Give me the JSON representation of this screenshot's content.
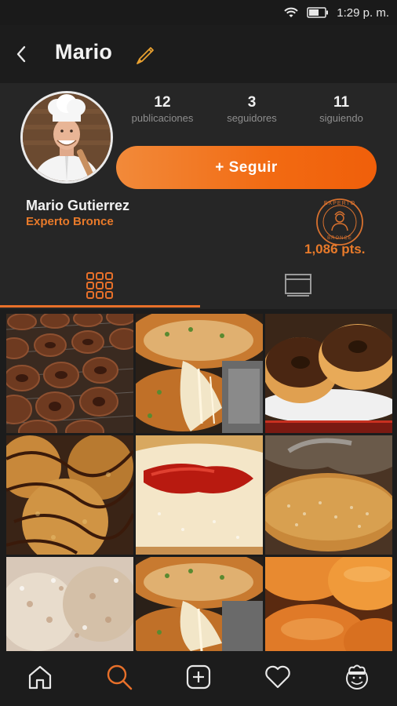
{
  "status_bar": {
    "time": "1:29 p. m.",
    "wifi_icon": "wifi-icon",
    "battery_icon": "battery-icon"
  },
  "header": {
    "back_icon": "back-arrow-icon",
    "title": "Mario",
    "edit_icon": "pencil-icon"
  },
  "profile": {
    "stats": [
      {
        "value": "12",
        "label": "publicaciones"
      },
      {
        "value": "3",
        "label": "seguidores"
      },
      {
        "value": "11",
        "label": "siguiendo"
      }
    ],
    "follow_button": "+ Seguir",
    "full_name": "Mario Gutierrez",
    "rank": "Experto Bronce",
    "badge": {
      "top_text": "EXPERTO",
      "bottom_text": "BRONCE"
    },
    "points": "1,086 pts."
  },
  "tabs": [
    {
      "name": "grid",
      "icon": "grid-icon",
      "active": true
    },
    {
      "name": "feed",
      "icon": "feed-icon",
      "active": false
    }
  ],
  "posts": [
    {
      "icon": "chocolate-donuts-rack-photo"
    },
    {
      "icon": "cheese-bread-photo"
    },
    {
      "icon": "chocolate-donuts-plate-photo"
    },
    {
      "icon": "chocolate-drizzle-pastries-photo"
    },
    {
      "icon": "jam-filled-donut-photo"
    },
    {
      "icon": "sugar-churro-donut-photo"
    },
    {
      "icon": "coconut-pastries-photo"
    },
    {
      "icon": "cheese-bread-photo"
    },
    {
      "icon": "bread-rolls-photo"
    }
  ],
  "bottom_nav": [
    {
      "name": "home",
      "icon": "home-icon"
    },
    {
      "name": "search",
      "icon": "search-icon",
      "active": true
    },
    {
      "name": "add",
      "icon": "add-icon"
    },
    {
      "name": "favorites",
      "icon": "heart-icon"
    },
    {
      "name": "profile",
      "icon": "chef-icon"
    }
  ],
  "colors": {
    "accent": "#e8702a",
    "background": "#1c1c1c",
    "panel": "#262626",
    "muted_text": "#8e8e8e"
  }
}
